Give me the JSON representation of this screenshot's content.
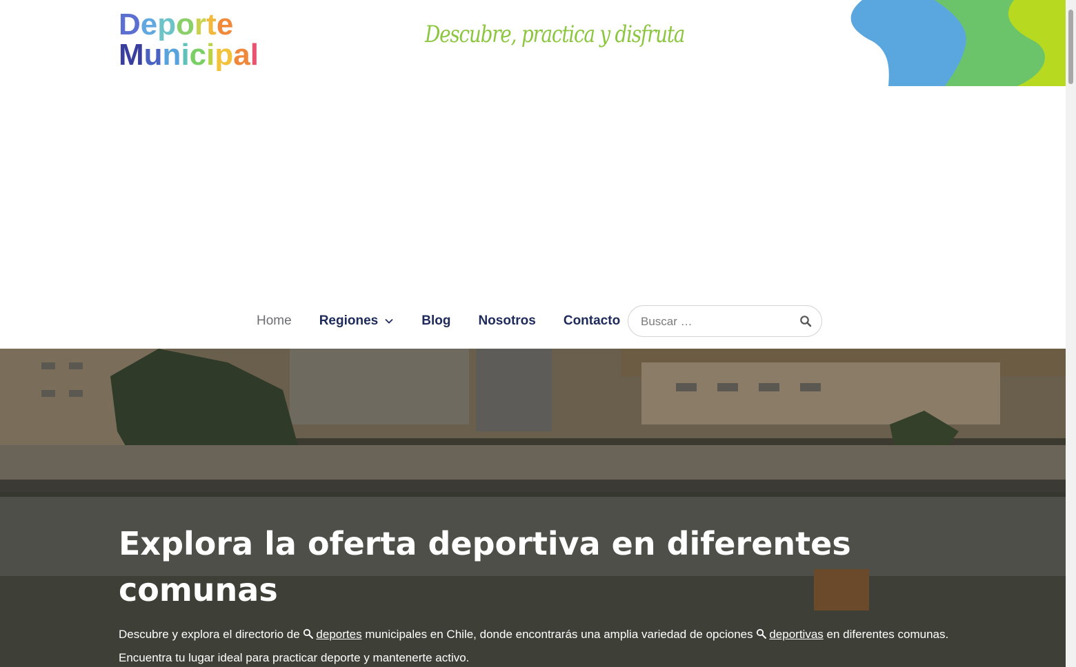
{
  "logo": {
    "line1": [
      "D",
      "e",
      "p",
      "o",
      "r",
      "t",
      "e"
    ],
    "line2": [
      "M",
      "u",
      "n",
      "i",
      "c",
      "i",
      "p",
      "a",
      "l"
    ]
  },
  "tagline": "Descubre, practica y disfruta",
  "nav": {
    "items": [
      {
        "label": "Home"
      },
      {
        "label": "Regiones"
      },
      {
        "label": "Blog"
      },
      {
        "label": "Nosotros"
      },
      {
        "label": "Contacto"
      }
    ]
  },
  "search": {
    "placeholder": "Buscar …"
  },
  "hero": {
    "title": "Explora la oferta deportiva en diferentes comunas",
    "text_part1": "Descubre y explora el directorio de ",
    "link1": "deportes",
    "text_part2": " municipales en Chile, donde encontrarás una amplia variedad de opciones ",
    "link2": "deportivas",
    "text_part3": " en diferentes comunas. Encuentra tu lugar ideal para practicar deporte y mantenerte activo."
  },
  "colors": {
    "brand_green": "#8cc63f",
    "nav_text": "#1e2a5a",
    "wave_blue": "#5aa7df",
    "wave_green": "#6cc46a",
    "wave_lime": "#b7d91f"
  },
  "icons": {
    "search": "search-icon",
    "chevron": "chevron-down-icon",
    "link_magnifier": "magnifier-icon"
  }
}
